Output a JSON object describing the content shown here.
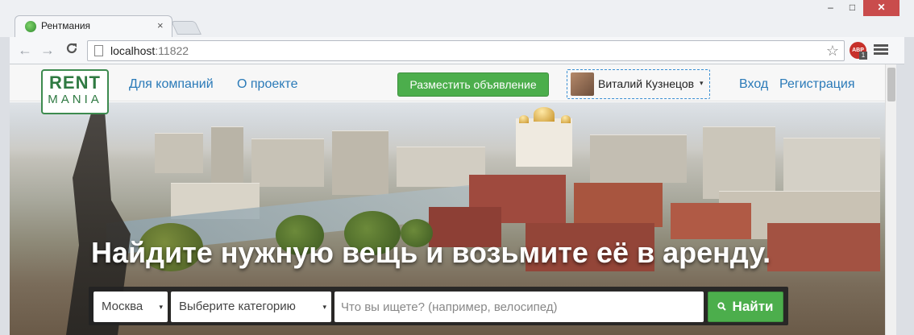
{
  "browser": {
    "tab": {
      "title": "Рентмания",
      "close": "×"
    },
    "window_controls": {
      "minimize": "–",
      "maximize": "□",
      "close": "✕"
    },
    "nav": {
      "back": "←",
      "forward": "→",
      "reload": "C"
    },
    "address": {
      "host": "localhost",
      "port": ":11822"
    },
    "icons": {
      "bookmark": "star-icon",
      "adblock": "ABP",
      "adblock_count": "1",
      "menu": "menu-icon"
    }
  },
  "site": {
    "logo": {
      "top": "RENT",
      "bottom": "MANIA",
      "color": "#2f7a42"
    },
    "header": {
      "for_companies": "Для компаний",
      "about": "О проекте",
      "post_button": "Разместить объявление",
      "user_name": "Виталий Кузнецов",
      "user_caret": "▾",
      "login": "Вход",
      "register": "Регистрация"
    },
    "hero": {
      "title": "Найдите нужную вещь и возьмите её в аренду.",
      "search": {
        "city": "Москва",
        "category": "Выберите категорию",
        "caret": "▾",
        "placeholder": "Что вы ищете? (например, велосипед)",
        "button": "Найти",
        "button_icon": "🔍︎"
      }
    },
    "colors": {
      "accent": "#4cae4c",
      "link": "#2a7ab8"
    }
  }
}
